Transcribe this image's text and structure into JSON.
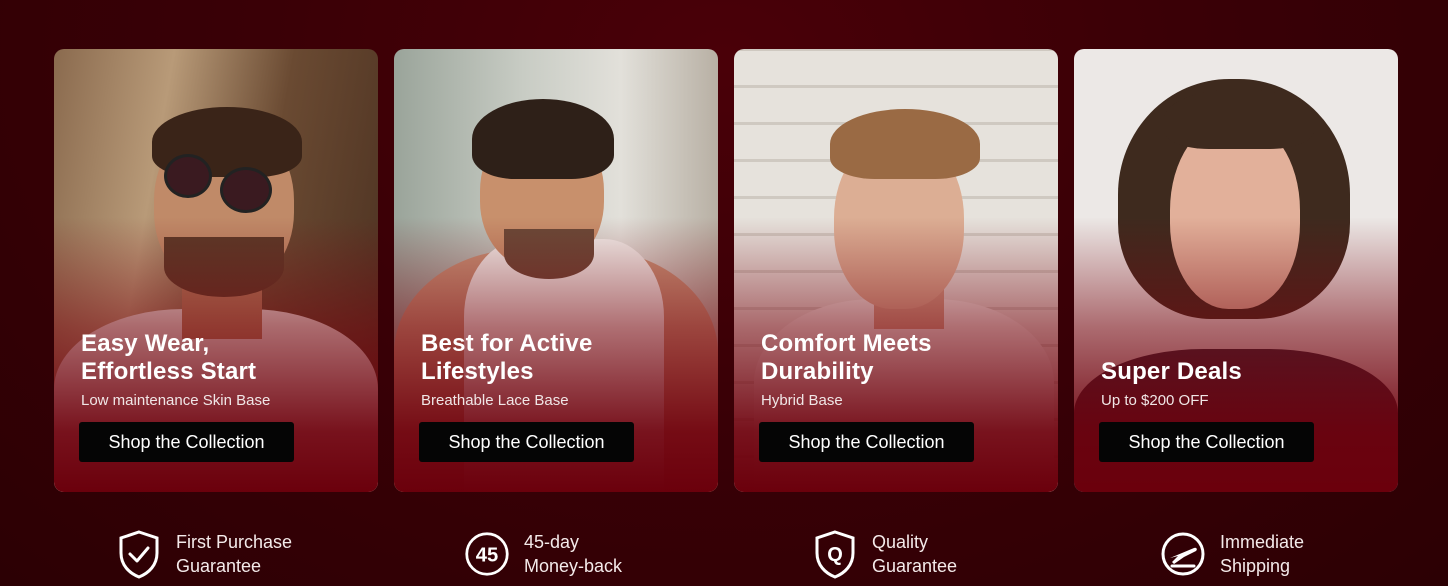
{
  "cards": [
    {
      "title": "Easy Wear,\nEffortless Start",
      "subtitle": "Low maintenance Skin Base",
      "button": "Shop the Collection"
    },
    {
      "title": "Best for Active\nLifestyles",
      "subtitle": "Breathable Lace Base",
      "button": "Shop the Collection"
    },
    {
      "title": "Comfort Meets\nDurability",
      "subtitle": "Hybrid Base",
      "button": "Shop the Collection"
    },
    {
      "title": "Super Deals",
      "subtitle": "Up to $200 OFF",
      "button": "Shop the Collection"
    }
  ],
  "features": [
    {
      "icon": "shield-check-icon",
      "label": "First Purchase\nGuarantee"
    },
    {
      "icon": "45-day-badge-icon",
      "badge": "45",
      "label": "45-day\nMoney-back"
    },
    {
      "icon": "quality-shield-icon",
      "badge": "Q",
      "label": "Quality\nGuarantee"
    },
    {
      "icon": "airplane-icon",
      "label": "Immediate\nShipping"
    }
  ],
  "colors": {
    "background": "#3a0006",
    "button": "#050505",
    "text": "#ffffff"
  }
}
